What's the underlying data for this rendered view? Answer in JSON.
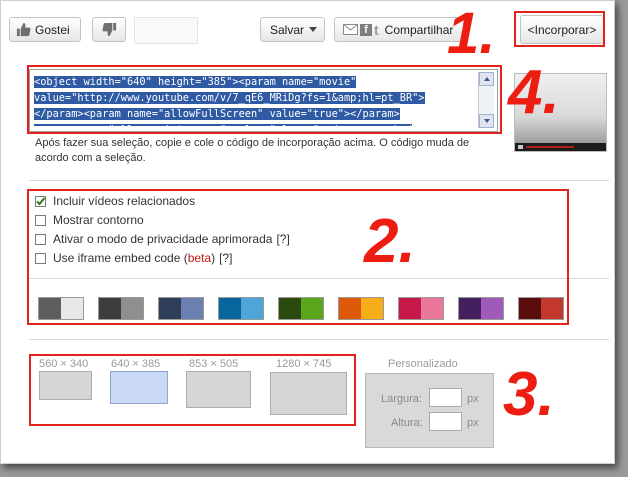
{
  "toolbar": {
    "like_label": "Gostei",
    "like_icon": "thumbs-up-icon",
    "dislike_icon": "thumbs-down-icon",
    "save_label": "Salvar",
    "share_label": "Compartilhar",
    "embed_label": "<Incorporar>"
  },
  "embed": {
    "code": [
      "<object width=\"640\" height=\"385\"><param name=\"movie\"",
      "value=\"http://www.youtube.com/v/7_qE6_MRiDg?fs=1&amp;hl=pt_BR\">",
      "</param><param name=\"allowFullScreen\" value=\"true\"></param>",
      "<param name=\"allowscriptaccess\" value=\"always\"></param><embed"
    ],
    "hint": "Após fazer sua seleção, copie e cole o código de incorporação acima. O código muda de acordo com a seleção."
  },
  "options": {
    "related": "Incluir vídeos relacionados",
    "border": "Mostrar contorno",
    "privacy": "Ativar o modo de privacidade aprimorada",
    "privacy_help": "[?]",
    "iframe_pre": "Use iframe embed code (",
    "iframe_beta": "beta",
    "iframe_post": ")",
    "iframe_help": "[?]",
    "related_checked": true
  },
  "colors": [
    [
      "#5e5e5e",
      "#e8e8e8"
    ],
    [
      "#3c3c3c",
      "#8f8f8f"
    ],
    [
      "#2e3e59",
      "#6b7fb0"
    ],
    [
      "#08669c",
      "#4ea5d8"
    ],
    [
      "#2a4a0e",
      "#5aa61c"
    ],
    [
      "#de5a0a",
      "#f7ad18"
    ],
    [
      "#c7184a",
      "#e9789b"
    ],
    [
      "#44215e",
      "#a05ab9"
    ],
    [
      "#5a0d0d",
      "#c2382c"
    ]
  ],
  "sizes": {
    "s1": "560 × 340",
    "s2": "640 × 385",
    "s3": "853 × 505",
    "s4": "1280 × 745",
    "custom_title": "Personalizado",
    "width_label": "Largura:",
    "height_label": "Altura:",
    "unit": "px"
  },
  "annotations": {
    "n1": "1.",
    "n2": "2.",
    "n3": "3.",
    "n4": "4."
  }
}
